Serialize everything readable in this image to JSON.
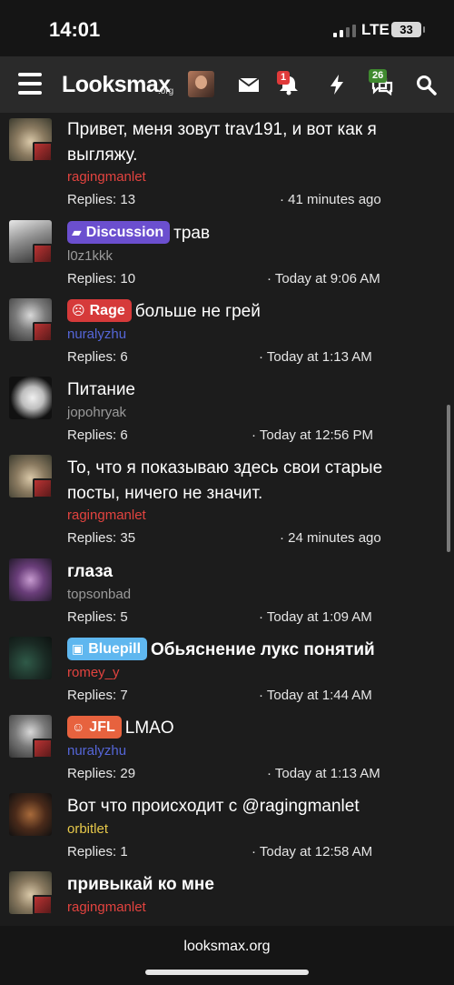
{
  "status": {
    "time": "14:01",
    "network": "LTE",
    "battery": "33"
  },
  "nav": {
    "logo": "Looksmax",
    "logo_suffix": ".org",
    "alerts_count": "1",
    "conversations_count": "26"
  },
  "colors": {
    "discussion": "#6b4fcf",
    "rage": "#d63a3a",
    "bluepill": "#5fb7ef",
    "jfl": "#e7623e",
    "author_red": "#e2433f",
    "author_blue": "#5566d8",
    "author_yellow": "#e6c84a",
    "author_gray": "#9a9a9a"
  },
  "threads": [
    {
      "title": "Привет, меня зовут trav191, и вот как я выгляжу.",
      "author": "ragingmanlet",
      "replies": "Replies: 13",
      "time": "· 41 minutes ago"
    },
    {
      "prefix": "Discussion",
      "title": "трав",
      "author": "l0z1kkk",
      "replies": "Replies: 10",
      "time": "· Today at 9:06 AM"
    },
    {
      "prefix": "Rage",
      "title": "больше не грей",
      "author": "nuralyzhu",
      "replies": "Replies: 6",
      "time": "· Today at 1:13 AM"
    },
    {
      "title": "Питание",
      "author": "jopohryak",
      "replies": "Replies: 6",
      "time": "· Today at 12:56 PM"
    },
    {
      "title": "То, что я показываю здесь свои старые посты, ничего не значит.",
      "author": "ragingmanlet",
      "replies": "Replies: 35",
      "time": "· 24 minutes ago"
    },
    {
      "title": "глаза",
      "author": "topsonbad",
      "replies": "Replies: 5",
      "time": "· Today at 1:09 AM"
    },
    {
      "prefix": "Bluepill",
      "title": "Обьяснение лукс понятий",
      "author": "romey_y",
      "replies": "Replies: 7",
      "time": "· Today at 1:44 AM"
    },
    {
      "prefix": "JFL",
      "title": "LMAO",
      "author": "nuralyzhu",
      "replies": "Replies: 29",
      "time": "· Today at 1:13 AM"
    },
    {
      "title": "Вот что происходит с @ragingmanlet",
      "author": "orbitlet",
      "replies": "Replies: 1",
      "time": "· Today at 12:58 AM"
    },
    {
      "title": "привыкай ко мне",
      "author": "ragingmanlet"
    }
  ],
  "footer": {
    "url": "looksmax.org"
  }
}
